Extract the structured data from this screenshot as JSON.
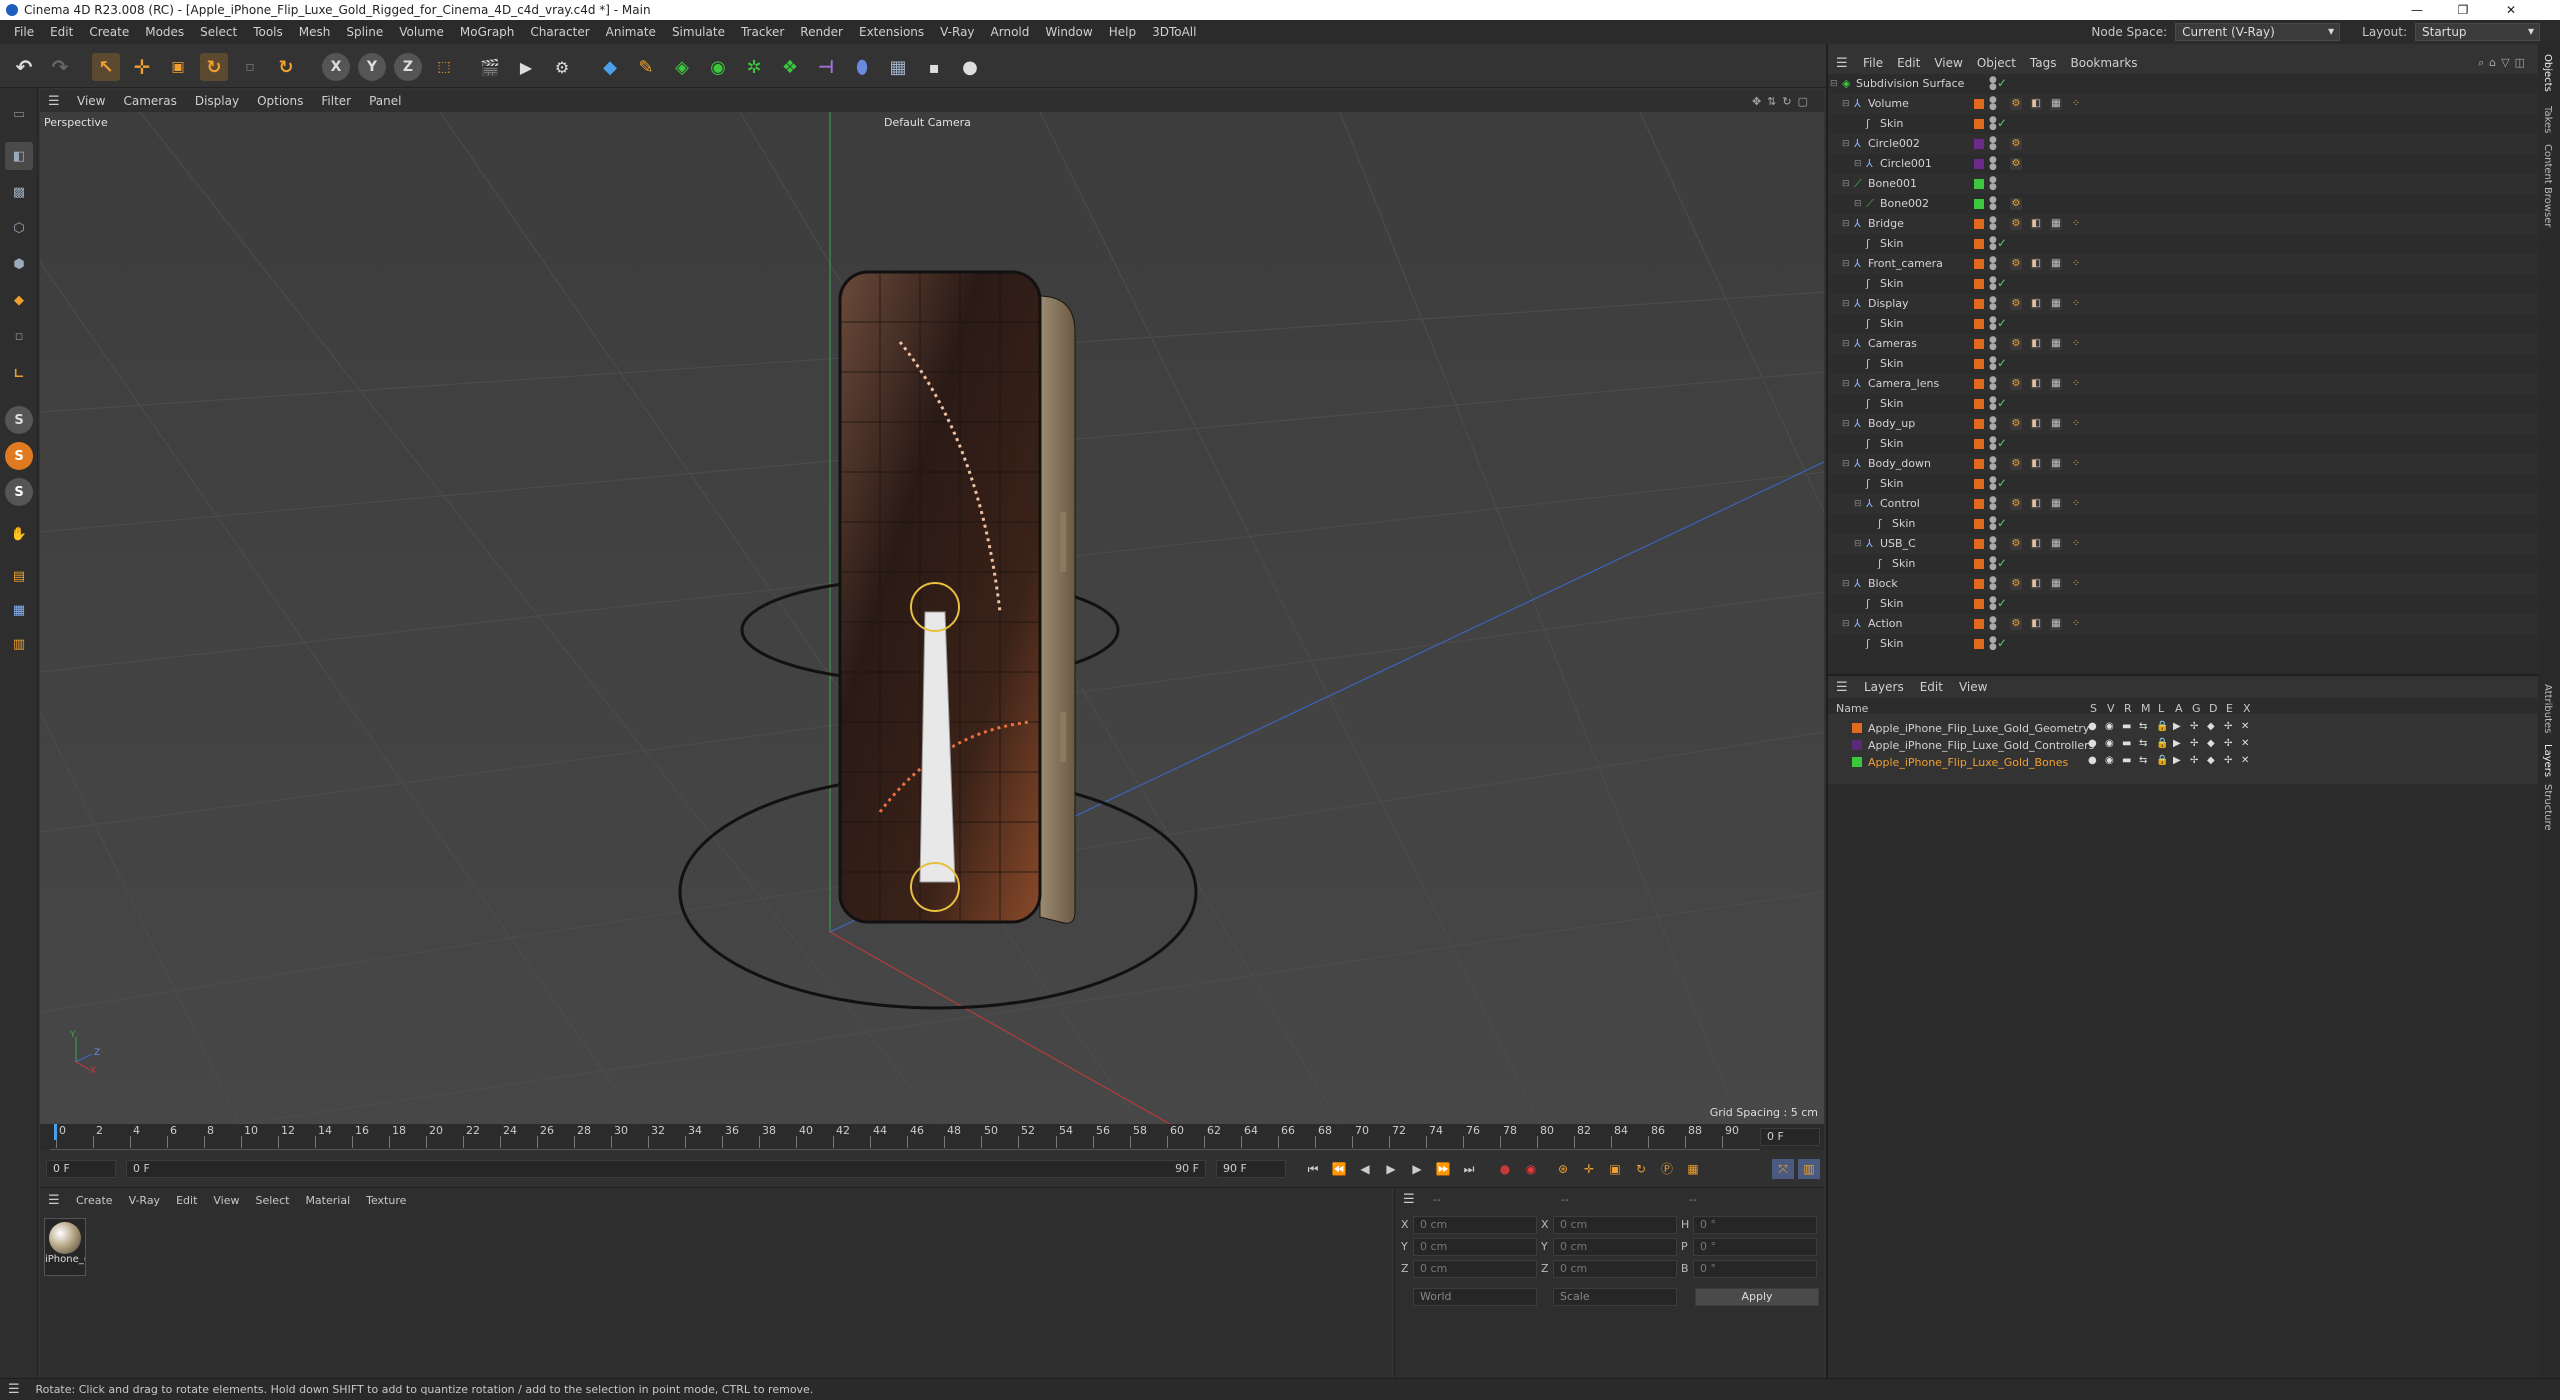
{
  "window": {
    "title": "Cinema 4D R23.008 (RC) - [Apple_iPhone_Flip_Luxe_Gold_Rigged_for_Cinema_4D_c4d_vray.c4d *] - Main",
    "controls": [
      "—",
      "❐",
      "✕"
    ]
  },
  "menubar": {
    "items": [
      "File",
      "Edit",
      "Create",
      "Modes",
      "Select",
      "Tools",
      "Mesh",
      "Spline",
      "Volume",
      "MoGraph",
      "Character",
      "Animate",
      "Simulate",
      "Tracker",
      "Render",
      "Extensions",
      "V-Ray",
      "Arnold",
      "Window",
      "Help",
      "3DToAll"
    ],
    "node_space_label": "Node Space:",
    "node_space_value": "Current (V-Ray)",
    "layout_label": "Layout:",
    "layout_value": "Startup"
  },
  "toolbar": {
    "axis_x": "X",
    "axis_y": "Y",
    "axis_z": "Z"
  },
  "left_tools": {
    "s1": "S",
    "s2": "S",
    "s3": "S"
  },
  "viewport": {
    "menu": [
      "View",
      "Cameras",
      "Display",
      "Options",
      "Filter",
      "Panel"
    ],
    "label": "Perspective",
    "camera": "Default Camera",
    "grid_spacing": "Grid Spacing : 5 cm",
    "axis_labels": {
      "y": "Y",
      "z": "Z",
      "x": "X"
    }
  },
  "timeline": {
    "ticks": [
      "0",
      "2",
      "4",
      "6",
      "8",
      "10",
      "12",
      "14",
      "16",
      "18",
      "20",
      "22",
      "24",
      "26",
      "28",
      "30",
      "32",
      "34",
      "36",
      "38",
      "40",
      "42",
      "44",
      "46",
      "48",
      "50",
      "52",
      "54",
      "56",
      "58",
      "60",
      "62",
      "64",
      "66",
      "68",
      "70",
      "72",
      "74",
      "76",
      "78",
      "80",
      "82",
      "84",
      "86",
      "88",
      "90"
    ],
    "current_frame": "0 F"
  },
  "transport": {
    "start": "0 F",
    "preview_start": "0 F",
    "preview_end": "90 F",
    "end": "90 F"
  },
  "material_panel": {
    "menu": [
      "Create",
      "V-Ray",
      "Edit",
      "View",
      "Select",
      "Material",
      "Texture"
    ],
    "material_name": "iPhone_("
  },
  "coord_panel": {
    "header": "--",
    "header2": "--",
    "header3": "--",
    "rows": [
      {
        "a": "X",
        "av": "0 cm",
        "b": "X",
        "bv": "0 cm",
        "c": "H",
        "cv": "0 °"
      },
      {
        "a": "Y",
        "av": "0 cm",
        "b": "Y",
        "bv": "0 cm",
        "c": "P",
        "cv": "0 °"
      },
      {
        "a": "Z",
        "av": "0 cm",
        "b": "Z",
        "bv": "0 cm",
        "c": "B",
        "cv": "0 °"
      }
    ],
    "world": "World",
    "scale": "Scale",
    "apply": "Apply"
  },
  "status": "Rotate: Click and drag to rotate elements. Hold down SHIFT to add to quantize rotation / add to the selection in point mode, CTRL to remove.",
  "objects": {
    "menu": [
      "File",
      "Edit",
      "View",
      "Object",
      "Tags",
      "Bookmarks"
    ],
    "rows": [
      {
        "name": "Subdivision Surface",
        "level": 0,
        "icon": "subd",
        "color": "",
        "tags": 0,
        "check": true
      },
      {
        "name": "Volume",
        "level": 1,
        "icon": "joint",
        "color": "#e06a1e",
        "tags": 4
      },
      {
        "name": "Skin",
        "level": 2,
        "icon": "skin",
        "color": "#e06a1e",
        "tags": 0,
        "check": true
      },
      {
        "name": "Circle002",
        "level": 1,
        "icon": "joint",
        "color": "#6b2a8c",
        "tags": 1
      },
      {
        "name": "Circle001",
        "level": 2,
        "icon": "joint",
        "color": "#6b2a8c",
        "tags": 1
      },
      {
        "name": "Bone001",
        "level": 1,
        "icon": "bone",
        "color": "#3cc83c",
        "tags": 0
      },
      {
        "name": "Bone002",
        "level": 2,
        "icon": "bone",
        "color": "#3cc83c",
        "tags": 1
      },
      {
        "name": "Bridge",
        "level": 1,
        "icon": "joint",
        "color": "#e06a1e",
        "tags": 4
      },
      {
        "name": "Skin",
        "level": 2,
        "icon": "skin",
        "color": "#e06a1e",
        "tags": 0,
        "check": true
      },
      {
        "name": "Front_camera",
        "level": 1,
        "icon": "joint",
        "color": "#e06a1e",
        "tags": 4
      },
      {
        "name": "Skin",
        "level": 2,
        "icon": "skin",
        "color": "#e06a1e",
        "tags": 0,
        "check": true
      },
      {
        "name": "Display",
        "level": 1,
        "icon": "joint",
        "color": "#e06a1e",
        "tags": 4
      },
      {
        "name": "Skin",
        "level": 2,
        "icon": "skin",
        "color": "#e06a1e",
        "tags": 0,
        "check": true
      },
      {
        "name": "Cameras",
        "level": 1,
        "icon": "joint",
        "color": "#e06a1e",
        "tags": 4
      },
      {
        "name": "Skin",
        "level": 2,
        "icon": "skin",
        "color": "#e06a1e",
        "tags": 0,
        "check": true
      },
      {
        "name": "Camera_lens",
        "level": 1,
        "icon": "joint",
        "color": "#e06a1e",
        "tags": 4
      },
      {
        "name": "Skin",
        "level": 2,
        "icon": "skin",
        "color": "#e06a1e",
        "tags": 0,
        "check": true
      },
      {
        "name": "Body_up",
        "level": 1,
        "icon": "joint",
        "color": "#e06a1e",
        "tags": 4
      },
      {
        "name": "Skin",
        "level": 2,
        "icon": "skin",
        "color": "#e06a1e",
        "tags": 0,
        "check": true
      },
      {
        "name": "Body_down",
        "level": 1,
        "icon": "joint",
        "color": "#e06a1e",
        "tags": 4
      },
      {
        "name": "Skin",
        "level": 2,
        "icon": "skin",
        "color": "#e06a1e",
        "tags": 0,
        "check": true
      },
      {
        "name": "Control",
        "level": 2,
        "icon": "joint",
        "color": "#e06a1e",
        "tags": 4
      },
      {
        "name": "Skin",
        "level": 3,
        "icon": "skin",
        "color": "#e06a1e",
        "tags": 0,
        "check": true
      },
      {
        "name": "USB_C",
        "level": 2,
        "icon": "joint",
        "color": "#e06a1e",
        "tags": 4
      },
      {
        "name": "Skin",
        "level": 3,
        "icon": "skin",
        "color": "#e06a1e",
        "tags": 0,
        "check": true
      },
      {
        "name": "Block",
        "level": 1,
        "icon": "joint",
        "color": "#e06a1e",
        "tags": 4
      },
      {
        "name": "Skin",
        "level": 2,
        "icon": "skin",
        "color": "#e06a1e",
        "tags": 0,
        "check": true
      },
      {
        "name": "Action",
        "level": 1,
        "icon": "joint",
        "color": "#e06a1e",
        "tags": 4
      },
      {
        "name": "Skin",
        "level": 2,
        "icon": "skin",
        "color": "#e06a1e",
        "tags": 0,
        "check": true
      }
    ]
  },
  "layers": {
    "menu": [
      "Layers",
      "Edit",
      "View"
    ],
    "columns": {
      "name": "Name",
      "flags": [
        "S",
        "V",
        "R",
        "M",
        "L",
        "A",
        "G",
        "D",
        "E",
        "X"
      ]
    },
    "rows": [
      {
        "name": "Apple_iPhone_Flip_Luxe_Gold_Geometry",
        "color": "#e06a1e",
        "active": false
      },
      {
        "name": "Apple_iPhone_Flip_Luxe_Gold_Controllers",
        "color": "#5a2a7a",
        "active": false
      },
      {
        "name": "Apple_iPhone_Flip_Luxe_Gold_Bones",
        "color": "#3cc83c",
        "active": true
      }
    ]
  },
  "side_tabs": [
    "Objects",
    "Takes",
    "Content Browser",
    "Attributes",
    "Layers",
    "Structure"
  ],
  "colors": {
    "accent": "#f0a030",
    "bg": "#333333",
    "viewport": "#424242"
  }
}
